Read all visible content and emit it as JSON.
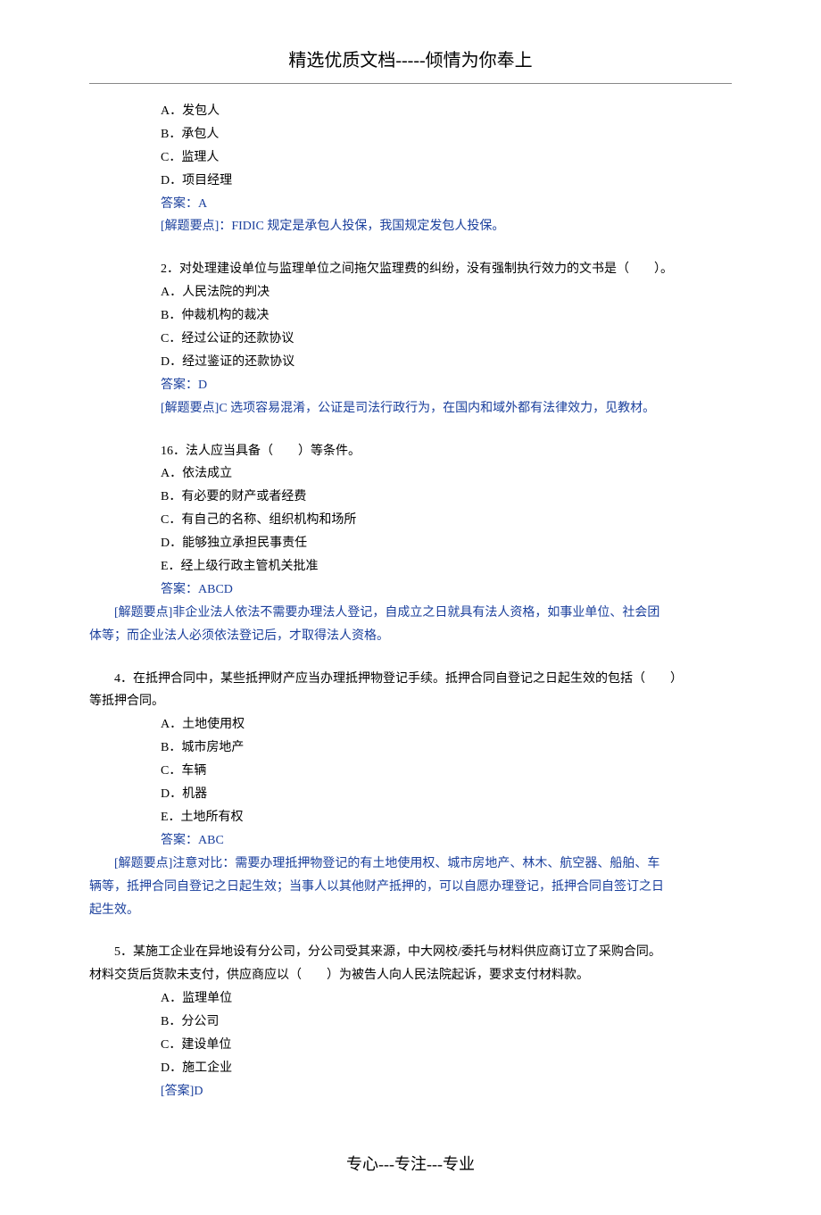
{
  "header": {
    "title": "精选优质文档-----倾情为你奉上"
  },
  "footer": {
    "text": "专心---专注---专业"
  },
  "q1": {
    "optA": "A．发包人",
    "optB": "B．承包人",
    "optC": "C．监理人",
    "optD": "D．项目经理",
    "answer": "答案：A",
    "explain": "[解题要点]：FIDIC 规定是承包人投保，我国规定发包人投保。"
  },
  "q2": {
    "stem": "2．对处理建设单位与监理单位之间拖欠监理费的纠纷，没有强制执行效力的文书是（　　）。",
    "optA": "A．人民法院的判决",
    "optB": "B．仲裁机构的裁决",
    "optC": "C．经过公证的还款协议",
    "optD": "D．经过鉴证的还款协议",
    "answer": "答案：D",
    "explain": "[解题要点]C 选项容易混淆，公证是司法行政行为，在国内和域外都有法律效力，见教材。"
  },
  "q16": {
    "stem": "16．法人应当具备（　　）等条件。",
    "optA": "A．依法成立",
    "optB": "B．有必要的财产或者经费",
    "optC": "C．有自己的名称、组织机构和场所",
    "optD": "D．能够独立承担民事责任",
    "optE": "E．经上级行政主管机关批准",
    "answer": "答案：ABCD",
    "explain_l1": "　　[解题要点]非企业法人依法不需要办理法人登记，自成立之日就具有法人资格，如事业单位、社会团",
    "explain_l2": "体等；而企业法人必须依法登记后，才取得法人资格。"
  },
  "q4": {
    "stem_l1": "　　4．在抵押合同中，某些抵押财产应当办理抵押物登记手续。抵押合同自登记之日起生效的包括（　　）",
    "stem_l2": "等抵押合同。",
    "optA": "A．土地使用权",
    "optB": "B．城市房地产",
    "optC": "C．车辆",
    "optD": "D．机器",
    "optE": "E．土地所有权",
    "answer": "答案：ABC",
    "explain_l1": "　　[解题要点]注意对比：需要办理抵押物登记的有土地使用权、城市房地产、林木、航空器、船舶、车",
    "explain_l2": "辆等，抵押合同自登记之日起生效；当事人以其他财产抵押的，可以自愿办理登记，抵押合同自签订之日",
    "explain_l3": "起生效。"
  },
  "q5": {
    "stem_l1": "　　5．某施工企业在异地设有分公司，分公司受其来源，中大网校/委托与材料供应商订立了采购合同。",
    "stem_l2": "材料交货后货款未支付，供应商应以（　　）为被告人向人民法院起诉，要求支付材料款。",
    "optA": "A．监理单位",
    "optB": "B．分公司",
    "optC": "C．建设单位",
    "optD": "D．施工企业",
    "answer": "[答案]D"
  }
}
